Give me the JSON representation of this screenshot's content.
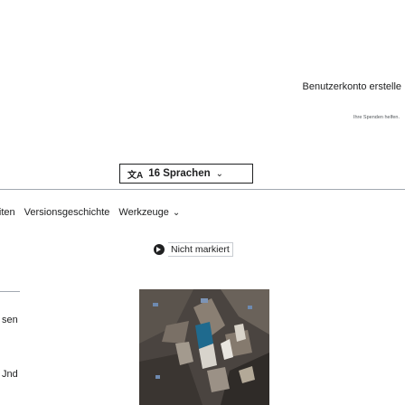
{
  "header": {
    "account_link": "Benutzerkonto erstelle",
    "donate_note": "Ihre Spenden helfen."
  },
  "language_button": {
    "icon": "translate-icon",
    "label": "16 Sprachen"
  },
  "tabs": [
    {
      "label": "rbeiten"
    },
    {
      "label": "Versionsgeschichte"
    },
    {
      "label": "Werkzeuge"
    }
  ],
  "flagged_revisions": {
    "status": "Nicht markiert"
  },
  "sidebar": {
    "fragment_1": "sen",
    "fragment_2": "Jnd"
  },
  "colors": {
    "text": "#202122",
    "border": "#a2a9b1"
  }
}
